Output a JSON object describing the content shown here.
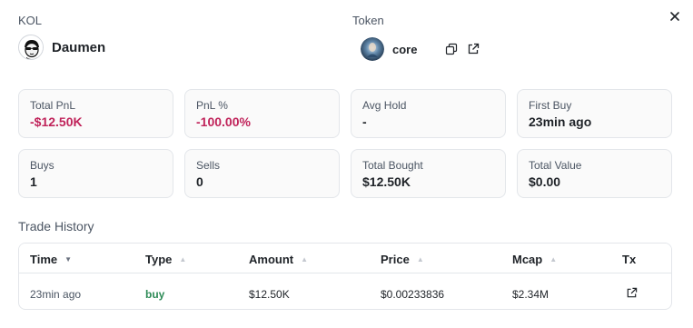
{
  "kol": {
    "section_label": "KOL",
    "name": "Daumen"
  },
  "token": {
    "section_label": "Token",
    "name": "core"
  },
  "stats": [
    {
      "label": "Total PnL",
      "value": "-$12.50K",
      "tone": "negative"
    },
    {
      "label": "PnL %",
      "value": "-100.00%",
      "tone": "negative"
    },
    {
      "label": "Avg Hold",
      "value": "-",
      "tone": "neutral"
    },
    {
      "label": "First Buy",
      "value": "23min ago",
      "tone": "neutral"
    },
    {
      "label": "Buys",
      "value": "1",
      "tone": "neutral"
    },
    {
      "label": "Sells",
      "value": "0",
      "tone": "neutral"
    },
    {
      "label": "Total Bought",
      "value": "$12.50K",
      "tone": "neutral"
    },
    {
      "label": "Total Value",
      "value": "$0.00",
      "tone": "neutral"
    }
  ],
  "trade_history": {
    "title": "Trade History",
    "columns": [
      "Time",
      "Type",
      "Amount",
      "Price",
      "Mcap",
      "Tx"
    ],
    "active_sort_column": "Time",
    "rows": [
      {
        "time": "23min ago",
        "type": "buy",
        "amount": "$12.50K",
        "price": "$0.00233836",
        "mcap": "$2.34M"
      }
    ]
  },
  "colors": {
    "negative": "#c0235a",
    "buy": "#2e8b57",
    "border": "#e3e6ea",
    "card_bg": "#fafafa"
  },
  "icons": [
    "close-icon",
    "copy-icon",
    "external-link-icon",
    "sort-chevron-icon"
  ]
}
